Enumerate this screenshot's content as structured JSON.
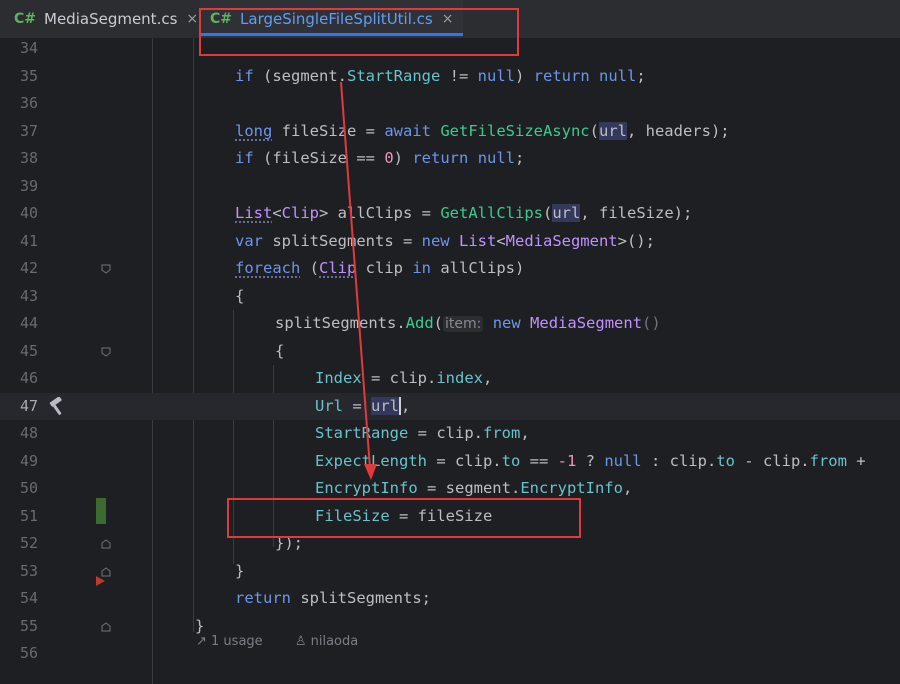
{
  "tabs": [
    {
      "lang": "C#",
      "title": "MediaSegment.cs",
      "close": "×"
    },
    {
      "lang": "C#",
      "title": "LargeSingleFileSplitUtil.cs",
      "close": "×"
    }
  ],
  "lines": [
    {
      "n": "34"
    },
    {
      "n": "35"
    },
    {
      "n": "36"
    },
    {
      "n": "37"
    },
    {
      "n": "38"
    },
    {
      "n": "39"
    },
    {
      "n": "40"
    },
    {
      "n": "41"
    },
    {
      "n": "42"
    },
    {
      "n": "43"
    },
    {
      "n": "44"
    },
    {
      "n": "45"
    },
    {
      "n": "46"
    },
    {
      "n": "47"
    },
    {
      "n": "48"
    },
    {
      "n": "49"
    },
    {
      "n": "50"
    },
    {
      "n": "51"
    },
    {
      "n": "52"
    },
    {
      "n": "53"
    },
    {
      "n": "54"
    },
    {
      "n": "55"
    },
    {
      "n": "56"
    }
  ],
  "code": {
    "l35": [
      "if",
      " (segment.",
      "StartRange",
      " != ",
      "null",
      ") ",
      "return",
      " ",
      "null",
      ";"
    ],
    "l37": [
      "long",
      " fileSize = ",
      "await",
      " ",
      "GetFileSizeAsync",
      "(",
      "url",
      ", headers);"
    ],
    "l38": [
      "if",
      " (fileSize == ",
      "0",
      ") ",
      "return",
      " ",
      "null",
      ";"
    ],
    "l40": [
      "List",
      "<",
      "Clip",
      "> allClips = ",
      "GetAllClips",
      "(",
      "url",
      ", fileSize);"
    ],
    "l41": [
      "var",
      " splitSegments = ",
      "new",
      " ",
      "List",
      "<",
      "MediaSegment",
      ">();"
    ],
    "l42": [
      "foreach",
      " (",
      "Clip",
      " clip ",
      "in",
      " allClips)"
    ],
    "l43": [
      "{"
    ],
    "l44": [
      "splitSegments.",
      "Add",
      "(",
      "item:",
      " ",
      "new",
      " ",
      "MediaSegment",
      "()"
    ],
    "l45": [
      "{"
    ],
    "l46": [
      "Index",
      " = clip.",
      "index",
      ","
    ],
    "l47": [
      "Url",
      " = ",
      "url",
      ","
    ],
    "l48": [
      "StartRange",
      " = clip.",
      "from",
      ","
    ],
    "l49": [
      "ExpectLength",
      " = clip.",
      "to",
      " == ",
      "-1",
      " ? ",
      "null",
      " : clip.",
      "to",
      " - clip.",
      "from",
      " +"
    ],
    "l50": [
      "EncryptInfo",
      " = segment.",
      "EncryptInfo",
      ","
    ],
    "l51": [
      "FileSize",
      " = fileSize"
    ],
    "l52": [
      "});"
    ],
    "l53": [
      "}"
    ],
    "l54": [
      "return",
      " splitSegments;"
    ],
    "l55": [
      "}"
    ]
  },
  "footer": {
    "usages": "1 usage",
    "author": "nilaoda"
  },
  "colors": {
    "annotation": "#e03b3b",
    "keyword": "#6c95eb",
    "type": "#c191ff",
    "property": "#66c3cc",
    "method": "#39cc8f",
    "number": "#ed94c0"
  },
  "icons": {
    "build": "hammer-icon",
    "fold": "fold-marker-icon"
  }
}
